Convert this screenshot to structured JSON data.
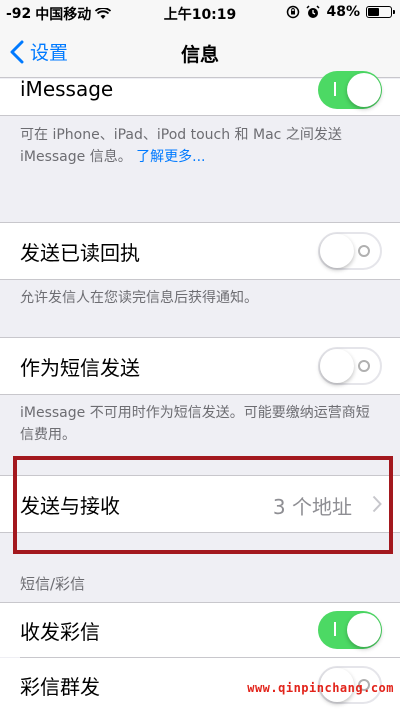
{
  "status_bar": {
    "signal": "-92",
    "carrier": "中国移动",
    "time": "上午10:19",
    "battery": "48%",
    "battery_level": 0.48
  },
  "nav": {
    "back_label": "设置",
    "title": "信息"
  },
  "imessage": {
    "label": "iMessage",
    "toggle_on": true,
    "footer": "可在 iPhone、iPad、iPod touch 和 Mac 之间发送 iMessage 信息。",
    "footer_link": "了解更多..."
  },
  "read_receipts": {
    "label": "发送已读回执",
    "toggle_on": false,
    "footer": "允许发信人在您读完信息后获得通知。"
  },
  "send_as_sms": {
    "label": "作为短信发送",
    "toggle_on": false,
    "footer": "iMessage 不可用时作为短信发送。可能要缴纳运营商短信费用。"
  },
  "send_receive": {
    "label": "发送与接收",
    "value": "3 个地址"
  },
  "sms_mms": {
    "header": "短信/彩信",
    "mms_label": "收发彩信",
    "mms_toggle_on": true,
    "group_label": "彩信群发",
    "group_toggle_on": false
  },
  "watermark": "www.qinpinchang.com",
  "colors": {
    "accent": "#007aff",
    "toggle_on": "#4cd964",
    "highlight": "#a3181e",
    "watermark": "#e2231a"
  }
}
